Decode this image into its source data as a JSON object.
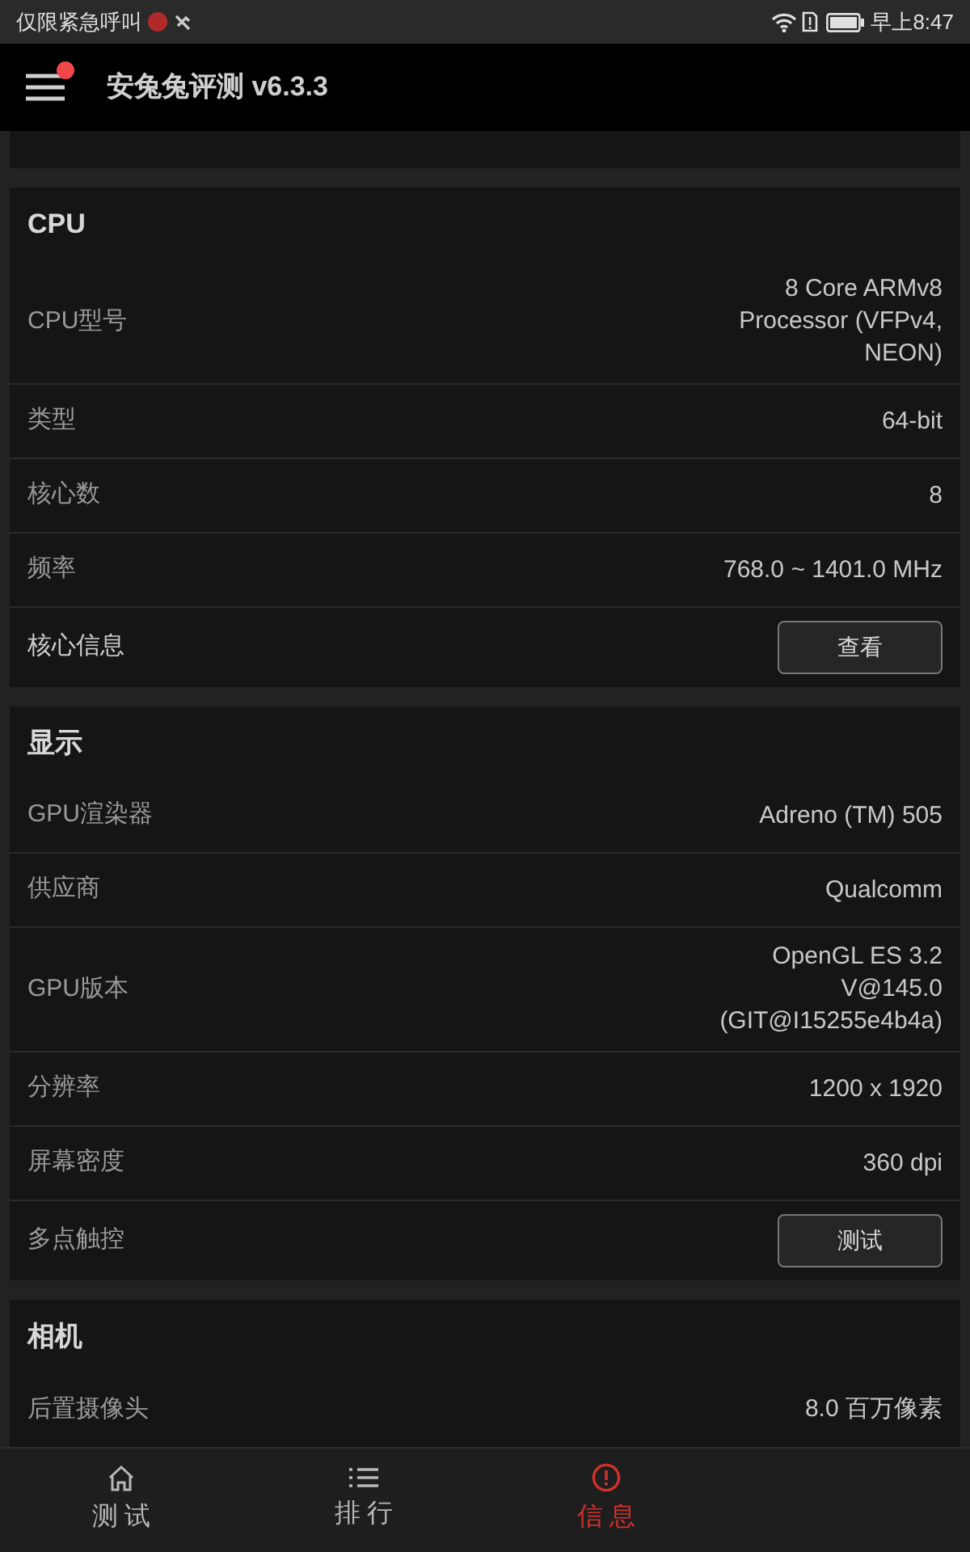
{
  "status_bar": {
    "carrier": "仅限紧急呼叫",
    "time": "早上8:47"
  },
  "app_bar": {
    "title": "安兔兔评测 v6.3.3",
    "menu_badge": true
  },
  "sections": [
    {
      "title": "CPU",
      "rows": [
        {
          "kind": "value",
          "label": "CPU型号",
          "value": "8 Core ARMv8 Processor (VFPv4, NEON)"
        },
        {
          "kind": "value",
          "label": "类型",
          "value": "64-bit"
        },
        {
          "kind": "value",
          "label": "核心数",
          "value": "8"
        },
        {
          "kind": "value",
          "label": "频率",
          "value": "768.0 ~ 1401.0 MHz"
        },
        {
          "kind": "button",
          "label": "核心信息",
          "button": "查看"
        }
      ]
    },
    {
      "title": "显示",
      "rows": [
        {
          "kind": "value",
          "label": "GPU渲染器",
          "value": "Adreno (TM) 505"
        },
        {
          "kind": "value",
          "label": "供应商",
          "value": "Qualcomm"
        },
        {
          "kind": "value",
          "label": "GPU版本",
          "value": "OpenGL ES 3.2 V@145.0 (GIT@I15255e4b4a)"
        },
        {
          "kind": "value",
          "label": "分辨率",
          "value": "1200 x 1920"
        },
        {
          "kind": "value",
          "label": "屏幕密度",
          "value": "360 dpi"
        },
        {
          "kind": "button",
          "label": "多点触控",
          "button": "测试"
        }
      ]
    },
    {
      "title": "相机",
      "rows": [
        {
          "kind": "value",
          "label": "后置摄像头",
          "value": "8.0 百万像素"
        }
      ]
    }
  ],
  "bottom_nav": [
    {
      "label": "测 试",
      "selected": false
    },
    {
      "label": "排 行",
      "selected": false
    },
    {
      "label": "信 息",
      "selected": true
    }
  ]
}
